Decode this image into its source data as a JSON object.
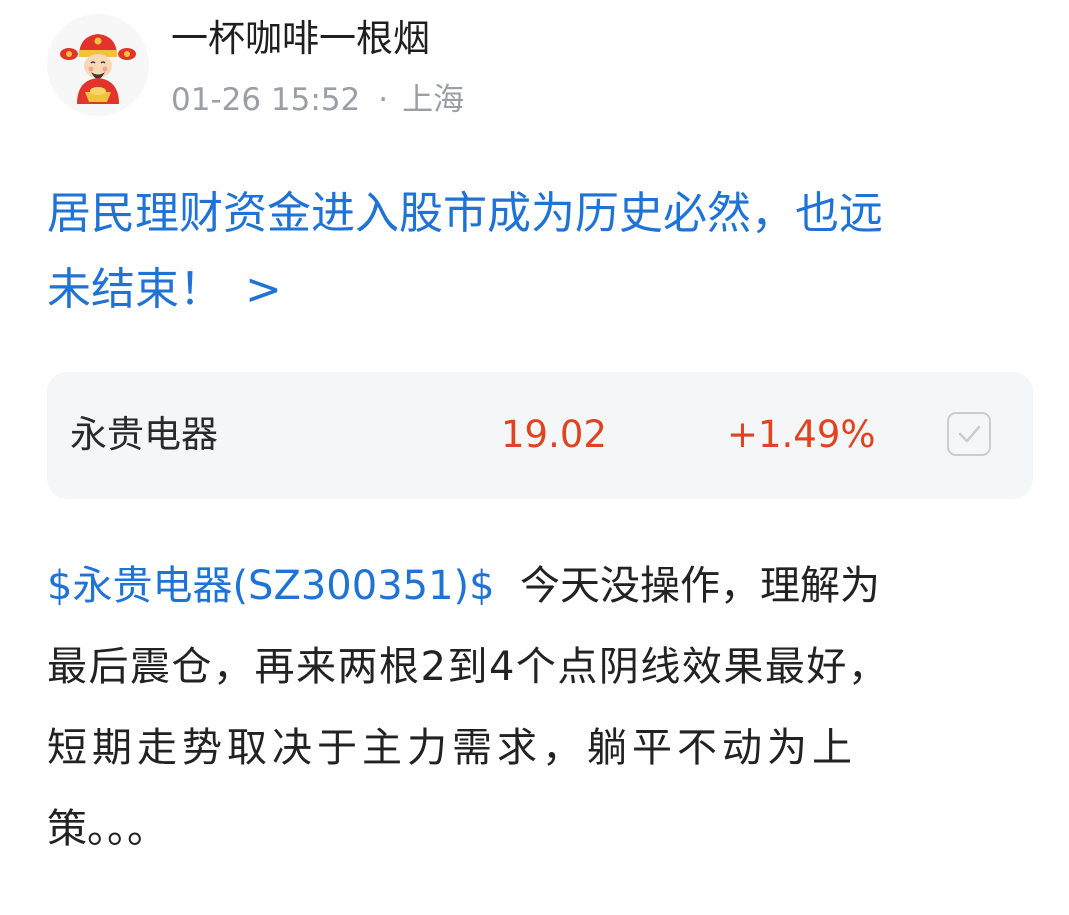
{
  "author": {
    "name": "一杯咖啡一根烟",
    "avatar_icon": "god-of-wealth-avatar-icon"
  },
  "meta": {
    "time": "01-26 15:52",
    "separator": "·",
    "location": "上海"
  },
  "post": {
    "title_line1": "居民理财资金进入股市成为历史必然，也远",
    "title_line2": "未结束！",
    "title_chevron": ">"
  },
  "stock_card": {
    "name": "永贵电器",
    "price": "19.02",
    "change": "+1.49%",
    "check_icon": "checkbox-check-icon"
  },
  "body": {
    "stock_link": "$永贵电器(SZ300351)$",
    "line1_rest": "今天没操作，理解为",
    "line2": "最后震仓，再来两根2到4个点阴线效果最好，",
    "line3": "短期走势取决于主力需求，躺平不动为上",
    "line4": "策。。。"
  },
  "colors": {
    "link_blue": "#1f72d6",
    "rise_red": "#e0431e",
    "meta_gray": "#9a9ea6",
    "card_bg": "#f5f6f8"
  }
}
